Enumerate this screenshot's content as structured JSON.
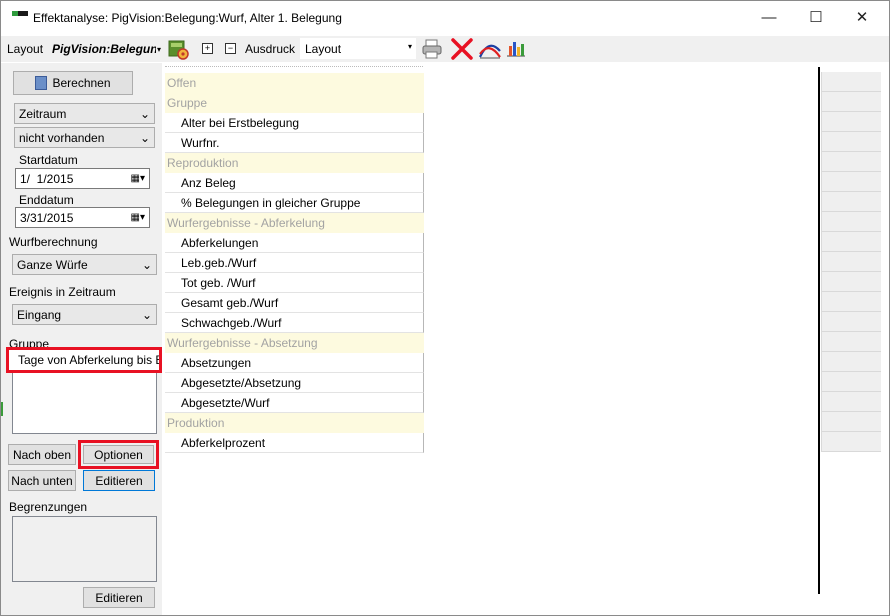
{
  "window": {
    "title": "Effektanalyse: PigVision:Belegung:Wurf, Alter 1. Belegung",
    "minimize": "—",
    "maximize": "☐",
    "close": "✕"
  },
  "toolbar": {
    "layout_label": "Layout",
    "layout_name": "PigVision:Belegung",
    "expand_icon": "+",
    "collapse_icon": "−",
    "print_label": "Ausdruck",
    "print_layout_value": "Layout"
  },
  "left": {
    "calculate_button": "Berechnen",
    "period_combo": "Zeitraum",
    "availability_combo": "nicht vorhanden",
    "start_label": "Startdatum",
    "start_value": "1/  1/2015",
    "end_label": "Enddatum",
    "end_value": "3/31/2015",
    "litter_calc_label": "Wurfberechnung",
    "litter_calc_value": "Ganze Würfe",
    "event_label": "Ereignis in Zeitraum",
    "event_value": "Eingang",
    "group_label": "Gruppe",
    "group_items": [
      "Tage von Abferkelung bis Be"
    ],
    "move_up_button": "Nach oben",
    "options_button": "Optionen",
    "move_down_button": "Nach unten",
    "edit_button": "Editieren",
    "limits_label": "Begrenzungen",
    "limits_edit_button": "Editieren"
  },
  "fields": [
    {
      "type": "cat",
      "label": "Offen"
    },
    {
      "type": "cat",
      "label": "Gruppe"
    },
    {
      "type": "item",
      "label": "Alter bei Erstbelegung"
    },
    {
      "type": "item",
      "label": "Wurfnr."
    },
    {
      "type": "cat",
      "label": "Reproduktion"
    },
    {
      "type": "item",
      "label": "Anz Beleg"
    },
    {
      "type": "item",
      "label": "% Belegungen in gleicher Gruppe"
    },
    {
      "type": "cat",
      "label": "Wurfergebnisse - Abferkelung"
    },
    {
      "type": "item",
      "label": "Abferkelungen"
    },
    {
      "type": "item",
      "label": "Leb.geb./Wurf"
    },
    {
      "type": "item",
      "label": "Tot geb. /Wurf"
    },
    {
      "type": "item",
      "label": "Gesamt geb./Wurf"
    },
    {
      "type": "item",
      "label": "Schwachgeb./Wurf"
    },
    {
      "type": "cat",
      "label": "Wurfergebnisse - Absetzung"
    },
    {
      "type": "item",
      "label": "Absetzungen"
    },
    {
      "type": "item",
      "label": "Abgesetzte/Absetzung"
    },
    {
      "type": "item",
      "label": "Abgesetzte/Wurf"
    },
    {
      "type": "cat",
      "label": "Produktion"
    },
    {
      "type": "item",
      "label": "Abferkelprozent"
    }
  ],
  "colors": {
    "highlight": "#e81123",
    "category_bg": "#fdfadf",
    "category_text": "#a3a3a3",
    "toolbar_bg": "#f0f0f0"
  }
}
